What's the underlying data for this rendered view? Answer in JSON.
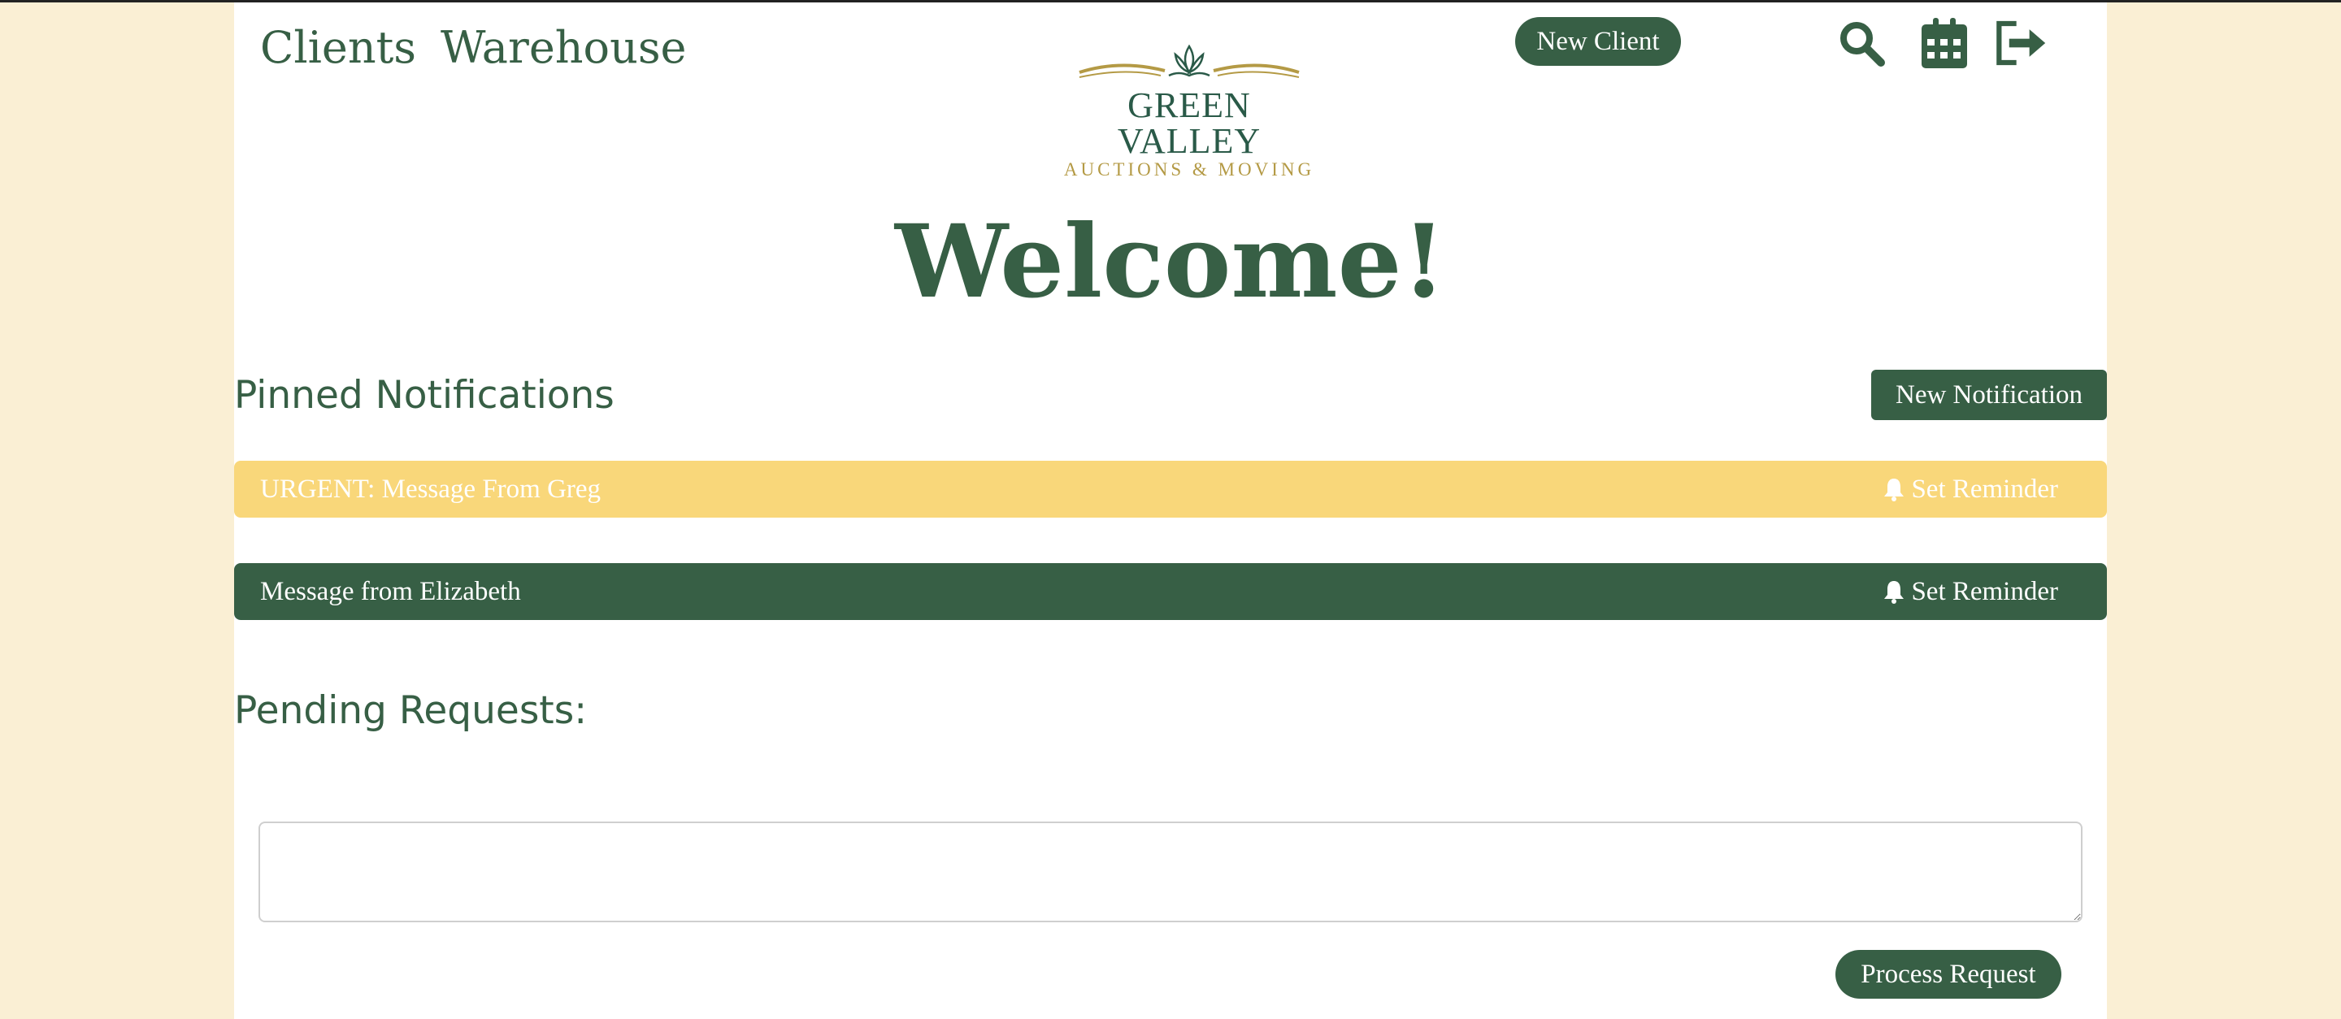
{
  "nav": {
    "clients": "Clients",
    "warehouse": "Warehouse",
    "new_client": "New Client",
    "icons": [
      "search-icon",
      "calendar-icon",
      "logout-icon"
    ]
  },
  "logo": {
    "line1": "GREEN VALLEY",
    "line2": "AUCTIONS & MOVING"
  },
  "welcome": "Welcome!",
  "pinned": {
    "title": "Pinned Notifications",
    "new_button": "New Notification",
    "items": [
      {
        "text": "URGENT: Message From Greg",
        "reminder": "Set Reminder",
        "status": "urgent"
      },
      {
        "text": "Message from Elizabeth",
        "reminder": "Set Reminder",
        "status": "normal"
      }
    ]
  },
  "pending": {
    "title": "Pending Requests:",
    "input_value": "",
    "process_button": "Process Request"
  },
  "colors": {
    "brand_green": "#375f45",
    "urgent_yellow": "#f9d77a",
    "background_cream": "#faefd4",
    "logo_gold": "#b49a45"
  }
}
